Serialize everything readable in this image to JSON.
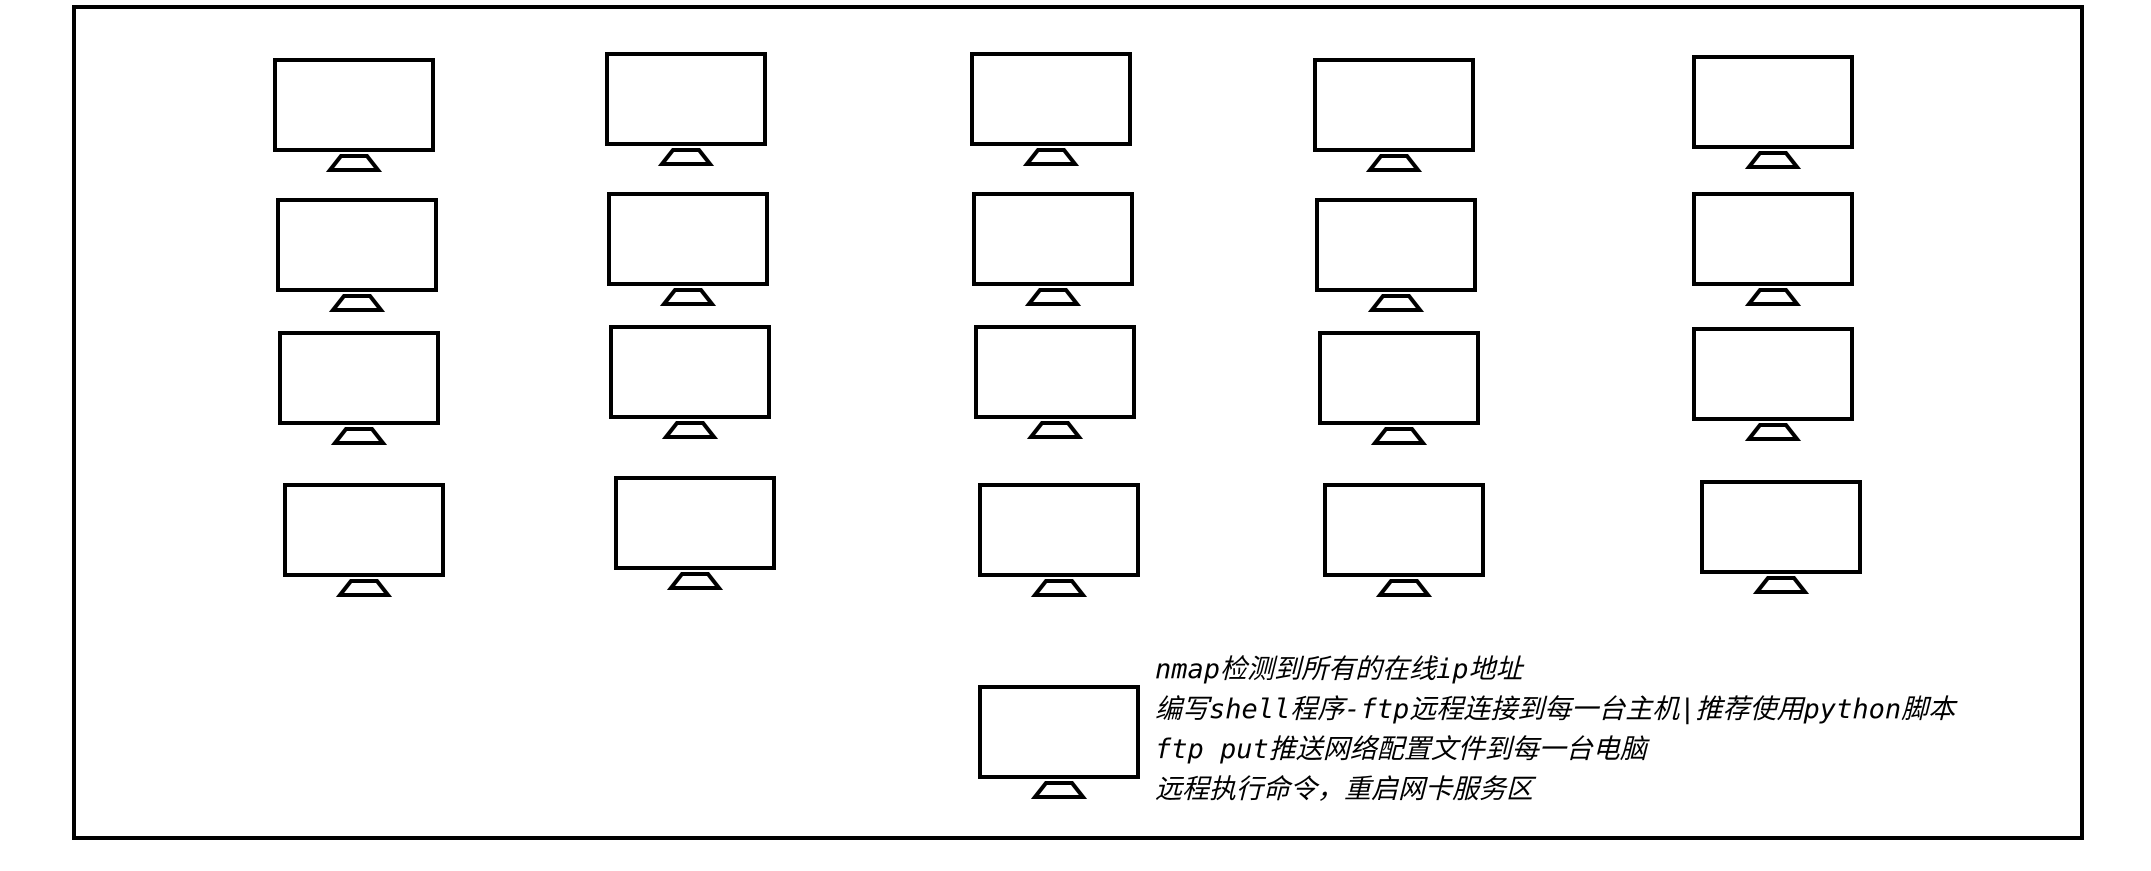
{
  "diagram": {
    "computer_grid": {
      "rows": 4,
      "columns": 5,
      "icon": "monitor-icon"
    },
    "controller": {
      "icon": "monitor-icon"
    },
    "notes": [
      "nmap检测到所有的在线ip地址",
      "编写shell程序-ftp远程连接到每一台主机|推荐使用python脚本",
      "ftp put推送网络配置文件到每一台电脑",
      "远程执行命令，重启网卡服务区"
    ],
    "colors": {
      "stroke": "#000000",
      "background": "#ffffff"
    }
  }
}
